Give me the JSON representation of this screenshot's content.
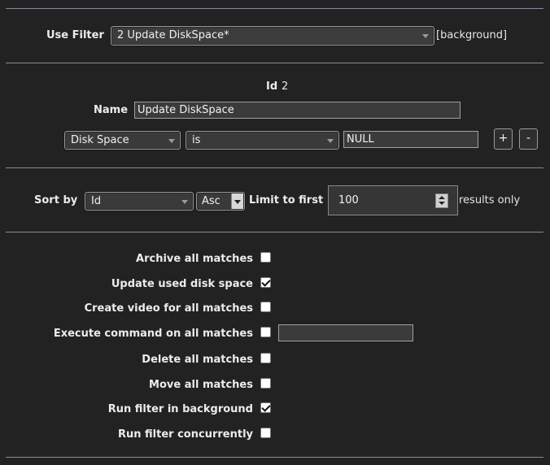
{
  "filter": {
    "use_filter_label": "Use Filter",
    "selected": "2 Update DiskSpace*",
    "background_tag": "[background]"
  },
  "details": {
    "id_label": "Id",
    "id_value": "2",
    "name_label": "Name",
    "name_value": "Update DiskSpace",
    "term": {
      "field": "Disk Space",
      "operator": "is",
      "value": "NULL"
    },
    "add_button": "+",
    "remove_button": "-"
  },
  "sort": {
    "sort_by_label": "Sort by",
    "sort_field": "Id",
    "direction": "Asc",
    "limit_label": "Limit to first",
    "limit_value": "100",
    "results_only": "results only"
  },
  "actions": [
    {
      "label": "Archive all matches",
      "checked": false
    },
    {
      "label": "Update used disk space",
      "checked": true
    },
    {
      "label": "Create video for all matches",
      "checked": false
    },
    {
      "label": "Execute command on all matches",
      "checked": false,
      "command_value": ""
    },
    {
      "label": "Delete all matches",
      "checked": false
    },
    {
      "label": "Move all matches",
      "checked": false
    },
    {
      "label": "Run filter in background",
      "checked": true
    },
    {
      "label": "Run filter concurrently",
      "checked": false
    }
  ]
}
